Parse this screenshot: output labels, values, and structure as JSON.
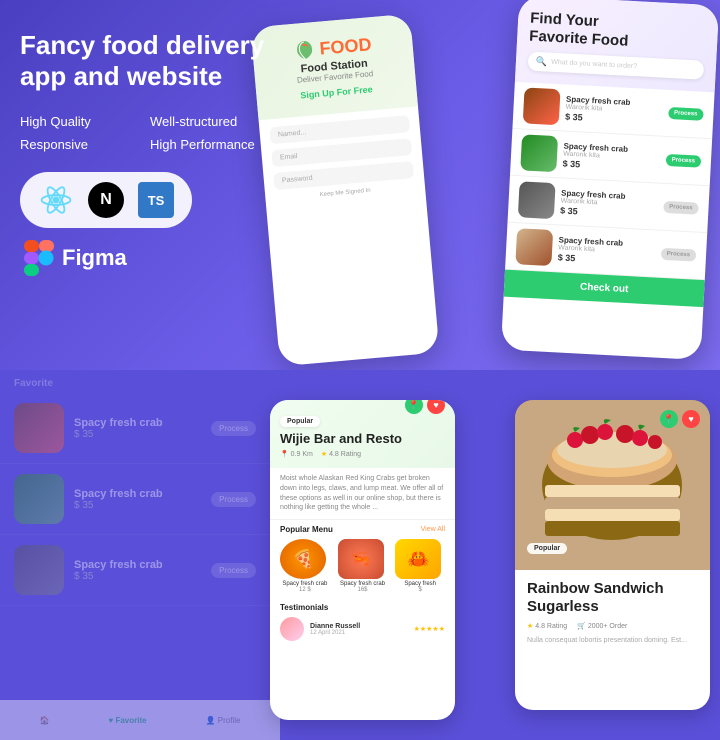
{
  "app": {
    "title": "Fancy food delivery app and website"
  },
  "hero": {
    "title": "Fancy food delivery app\nand website",
    "features": [
      "High Quality",
      "Well-structured",
      "Responsive",
      "High Performance"
    ],
    "tech_icons": [
      "React",
      "Next.js",
      "TypeScript"
    ],
    "figma_label": "Figma"
  },
  "phone_left": {
    "logo_text": "FOOD",
    "brand_name": "Food Station",
    "tagline": "Deliver Favorite Food",
    "signup_text": "Sign Up For Free",
    "fields": [
      "Named...",
      "Email",
      "Password"
    ],
    "keep_signed": "Keep Me Signed In"
  },
  "phone_right": {
    "title": "Find Your\nFavorite Food",
    "search_placeholder": "What do you want to order?",
    "items": [
      {
        "name": "Spacy fresh crab",
        "sub": "Warorik kita",
        "price": "$ 35",
        "btn": "Process"
      },
      {
        "name": "Spacy fresh crab",
        "sub": "Warorik kita",
        "price": "$ 35",
        "btn": "Process"
      },
      {
        "name": "Spacy fresh crab",
        "sub": "Warorik kita",
        "price": "$ 35",
        "btn": "Process"
      },
      {
        "name": "Spacy fresh crab",
        "sub": "Warorik kita",
        "price": "$ 35",
        "btn": "Process"
      }
    ],
    "checkout_label": "Check out"
  },
  "bg_items": [
    {
      "name": "Spacy fresh crab",
      "price": "$ 35",
      "btn": "Process"
    },
    {
      "name": "Spacy fresh crab",
      "price": "$ 35",
      "btn": "Process"
    },
    {
      "name": "Spacy fresh crab",
      "price": "$ 35",
      "btn": "Process"
    }
  ],
  "bottom_nav": [
    "Favorite",
    "Profile"
  ],
  "restaurant_card": {
    "badge": "Popular",
    "name": "Wijie Bar and Resto",
    "km": "0.9 Km",
    "rating": "4.8 Rating",
    "description": "Moist whole Alaskan Red King Crabs get broken down into legs, claws, and lump meat. We offer all of these options as well in our online shop, but there is nothing like getting the whole ...",
    "popular_menu_label": "Popular Menu",
    "view_all": "View All",
    "menu_items": [
      {
        "name": "Spacy fresh crab",
        "price": "12 $"
      },
      {
        "name": "Spacy fresh crab",
        "price": "16$"
      }
    ],
    "testimonials_label": "Testimonials",
    "testimonial": {
      "name": "Dianne Russell",
      "date": "12 April 2021",
      "stars": 5
    }
  },
  "food_card": {
    "badge": "Popular",
    "title": "Rainbow Sandwich\nSugarless",
    "rating": "4.8 Rating",
    "orders": "2000+ Order",
    "description": "Nulla consequat lobortis presentation doming. Est..."
  },
  "colors": {
    "primary_bg": "#5a4fd8",
    "accent_green": "#2ecc71",
    "accent_orange": "#ff9a4d",
    "accent_red": "#ff4444",
    "white": "#ffffff"
  }
}
